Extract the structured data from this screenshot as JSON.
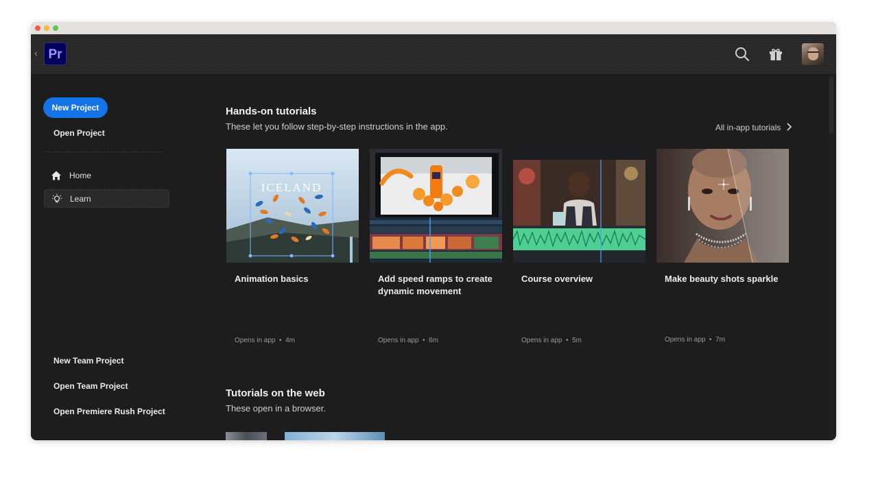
{
  "app": {
    "logo_text": "Pr"
  },
  "header": {
    "icons": [
      "search-icon",
      "gift-icon",
      "user-avatar"
    ]
  },
  "sidebar": {
    "new_project_label": "New Project",
    "open_project_label": "Open Project",
    "nav": [
      {
        "label": "Home",
        "icon": "home-icon",
        "selected": false
      },
      {
        "label": "Learn",
        "icon": "lightbulb-icon",
        "selected": true
      }
    ],
    "bottom_links": [
      "New Team Project",
      "Open Team Project",
      "Open Premiere Rush Project"
    ]
  },
  "hands_on": {
    "title": "Hands-on tutorials",
    "subtitle": "These let you follow step-by-step instructions in the app.",
    "all_link": "All in-app tutorials",
    "cards": [
      {
        "title": "Animation basics",
        "meta": "Opens in app",
        "duration": "4m",
        "thumb_text": "ICELAND"
      },
      {
        "title": "Add speed ramps to create dynamic movement",
        "meta": "Opens in app",
        "duration": "6m"
      },
      {
        "title": "Course overview",
        "meta": "Opens in app",
        "duration": "5m"
      },
      {
        "title": "Make beauty shots sparkle",
        "meta": "Opens in app",
        "duration": "7m"
      }
    ]
  },
  "web": {
    "title": "Tutorials on the web",
    "subtitle": "These open in a browser."
  },
  "colors": {
    "accent": "#1473e6",
    "background": "#1d1d1d",
    "logo_bg": "#00005b",
    "logo_text": "#9999ff"
  }
}
